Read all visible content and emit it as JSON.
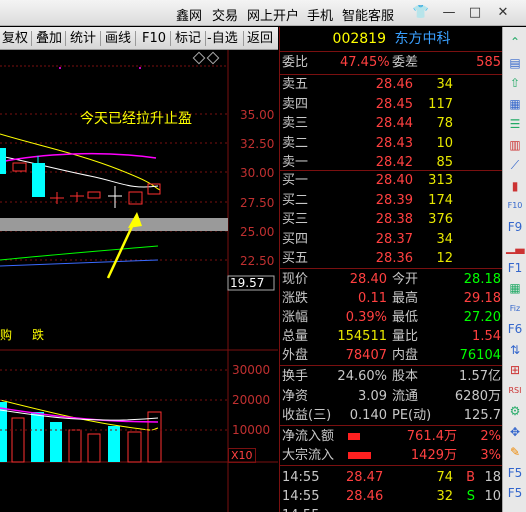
{
  "menu": {
    "items": [
      "鑫网",
      "交易",
      "网上开户",
      "手机",
      "智能客服"
    ],
    "window_buttons": [
      "shirt",
      "minimize",
      "maximize",
      "close"
    ]
  },
  "toolbar": {
    "buttons": [
      "复权",
      "叠加",
      "统计",
      "画线",
      "F10",
      "标记",
      "-自选",
      "返回"
    ]
  },
  "chart": {
    "annotation": "今天已经拉升止盈",
    "price_ticks": [
      "35.00",
      "32.50",
      "30.00",
      "27.50",
      "25.00",
      "22.50"
    ],
    "current_price_box": "19.57",
    "indicator_labels": [
      "购",
      "跌"
    ],
    "volume_ticks": [
      "30000",
      "20000",
      "10000"
    ],
    "volume_unit": "X10",
    "colors": {
      "up": "#ff3030",
      "down": "#00ffff",
      "ma5": "#ffffff",
      "ma10": "#ffff00",
      "ma20": "#ff00ff",
      "ma60": "#00ff00"
    }
  },
  "stock": {
    "code": "002819",
    "name": "东方中科"
  },
  "order_book": {
    "ratio_label": "委比",
    "ratio_value": "47.45%",
    "diff_label": "委差",
    "diff_value": "585",
    "asks": [
      {
        "label": "卖五",
        "price": "28.46",
        "volume": "34"
      },
      {
        "label": "卖四",
        "price": "28.45",
        "volume": "117"
      },
      {
        "label": "卖三",
        "price": "28.44",
        "volume": "78"
      },
      {
        "label": "卖二",
        "price": "28.43",
        "volume": "10"
      },
      {
        "label": "卖一",
        "price": "28.42",
        "volume": "85"
      }
    ],
    "bids": [
      {
        "label": "买一",
        "price": "28.40",
        "volume": "313"
      },
      {
        "label": "买二",
        "price": "28.39",
        "volume": "174"
      },
      {
        "label": "买三",
        "price": "28.38",
        "volume": "376"
      },
      {
        "label": "买四",
        "price": "28.37",
        "volume": "34"
      },
      {
        "label": "买五",
        "price": "28.36",
        "volume": "12"
      }
    ]
  },
  "quote": [
    {
      "l1": "现价",
      "v1": "28.40",
      "l2": "今开",
      "v2": "28.18",
      "c1": "#ff4040",
      "c2": "#00ff00"
    },
    {
      "l1": "涨跌",
      "v1": "0.11",
      "l2": "最高",
      "v2": "29.18",
      "c1": "#ff4040",
      "c2": "#ff4040"
    },
    {
      "l1": "涨幅",
      "v1": "0.39%",
      "l2": "最低",
      "v2": "27.20",
      "c1": "#ff4040",
      "c2": "#00ff00"
    },
    {
      "l1": "总量",
      "v1": "154511",
      "l2": "量比",
      "v2": "1.54",
      "c1": "#e8e800",
      "c2": "#ff4040"
    },
    {
      "l1": "外盘",
      "v1": "78407",
      "l2": "内盘",
      "v2": "76104",
      "c1": "#ff4040",
      "c2": "#00ff00"
    }
  ],
  "stats": [
    {
      "l1": "换手",
      "v1": "24.60%",
      "l2": "股本",
      "v2": "1.57亿"
    },
    {
      "l1": "净资",
      "v1": "3.09",
      "l2": "流通",
      "v2": "6280万"
    },
    {
      "l1": "收益(三)",
      "v1": "0.140",
      "l2": "PE(动)",
      "v2": "125.7"
    }
  ],
  "flows": [
    {
      "label": "净流入额",
      "value": "761.4万",
      "pct": "2%",
      "bar": 0.45
    },
    {
      "label": "大宗流入",
      "value": "1429万",
      "pct": "3%",
      "bar": 0.9
    }
  ],
  "ticks": [
    {
      "time": "14:55",
      "price": "28.47",
      "vol": "74",
      "side": "B",
      "num": "18"
    },
    {
      "time": "14:55",
      "price": "28.46",
      "vol": "32",
      "side": "S",
      "num": "10"
    },
    {
      "time": "14:55",
      "price": "",
      "vol": "",
      "side": "",
      "num": ""
    }
  ],
  "side_icons": [
    "collapse-up",
    "ticker",
    "up-arrow",
    "grid",
    "list",
    "bar",
    "line",
    "candle",
    "F10",
    "F9",
    "chart-bar",
    "F1",
    "vol",
    "Fiz",
    "F6",
    "arrows",
    "box",
    "RSI",
    "gear",
    "move",
    "pen",
    "F5",
    "F5b"
  ]
}
